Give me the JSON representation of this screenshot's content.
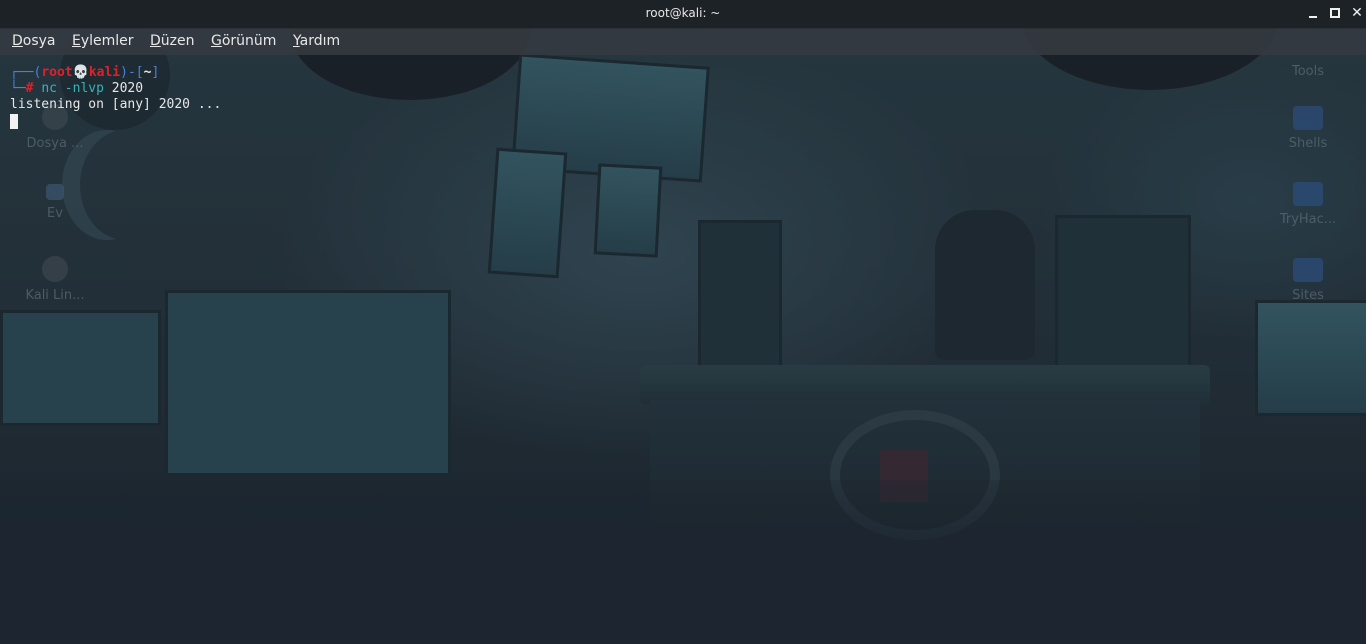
{
  "window": {
    "title": "root@kali: ~",
    "close_glyph": "✕"
  },
  "menu": [
    {
      "label_ul": "D",
      "label_rest": "osya"
    },
    {
      "label_ul": "E",
      "label_rest": "ylemler"
    },
    {
      "label_ul": "D",
      "label_rest": "üzen"
    },
    {
      "label_ul": "G",
      "label_rest": "örünüm"
    },
    {
      "label_ul": "Y",
      "label_rest": "ardım"
    }
  ],
  "terminal": {
    "prompt_open": "┌──(",
    "user": "root",
    "skull": "💀",
    "host": "kali",
    "prompt_mid": ")-[",
    "cwd": "~",
    "prompt_close": "]",
    "prompt2_prefix": "└─",
    "prompt_symbol": "#",
    "command": "nc -nlvp",
    "command_arg": "2020",
    "output_line": "listening on [any] 2020 ..."
  },
  "desktop_icons": [
    {
      "name": "Dosya ...",
      "icon": "disk-icon"
    },
    {
      "name": "Ev",
      "icon": "home-icon"
    },
    {
      "name": "Kali Lin...",
      "icon": "kali-icon"
    },
    {
      "name": "Tools",
      "icon": "folder-icon"
    },
    {
      "name": "Shells",
      "icon": "folder-icon"
    },
    {
      "name": "TryHac...",
      "icon": "folder-icon"
    },
    {
      "name": "Sites",
      "icon": "folder-icon"
    }
  ]
}
